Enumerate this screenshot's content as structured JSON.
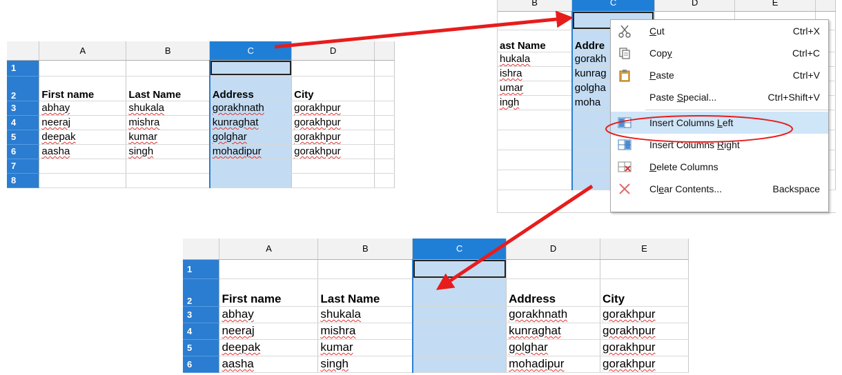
{
  "colors": {
    "accent": "#1f7fd6",
    "row_header": "#2a7dd1",
    "selection": "#c3dcf3",
    "arrow": "#e81c1c",
    "highlight": "#cfe5f8"
  },
  "before_sheet": {
    "col_headers": [
      "A",
      "B",
      "C",
      "D"
    ],
    "row_numbers": [
      "1",
      "2",
      "3",
      "4",
      "5",
      "6",
      "7",
      "8"
    ],
    "headers": [
      "First name",
      "Last Name",
      "Address",
      "City"
    ],
    "rows": [
      [
        "abhay",
        "shukala",
        "gorakhnath",
        "gorakhpur"
      ],
      [
        "neeraj",
        "mishra",
        "kunraghat",
        "gorakhpur"
      ],
      [
        "deepak",
        "kumar",
        "golghar",
        "gorakhpur"
      ],
      [
        "aasha",
        "singh",
        "mohadipur",
        "gorakhpur"
      ]
    ]
  },
  "menu_sheet": {
    "col_headers": [
      "B",
      "C",
      "D",
      "E"
    ],
    "header_fragments": [
      "ast Name",
      "Addre"
    ],
    "rows": [
      [
        "hukala",
        "gorakh"
      ],
      [
        "ishra",
        "kunrag"
      ],
      [
        "umar",
        "golgha"
      ],
      [
        "ingh",
        "moha"
      ]
    ]
  },
  "context_menu": {
    "items": [
      {
        "icon": "cut-icon",
        "pre": "",
        "key": "C",
        "post": "ut",
        "shortcut": "Ctrl+X"
      },
      {
        "icon": "copy-icon",
        "pre": "Cop",
        "key": "y",
        "post": "",
        "shortcut": "Ctrl+C"
      },
      {
        "icon": "paste-icon",
        "pre": "",
        "key": "P",
        "post": "aste",
        "shortcut": "Ctrl+V"
      },
      {
        "icon": "",
        "pre": "Paste ",
        "key": "S",
        "post": "pecial...",
        "shortcut": "Ctrl+Shift+V"
      },
      {
        "icon": "insert-columns-left-icon",
        "pre": "Insert Columns ",
        "key": "L",
        "post": "eft",
        "shortcut": ""
      },
      {
        "icon": "insert-columns-right-icon",
        "pre": "Insert Columns ",
        "key": "R",
        "post": "ight",
        "shortcut": ""
      },
      {
        "icon": "delete-columns-icon",
        "pre": "",
        "key": "D",
        "post": "elete Columns",
        "shortcut": ""
      },
      {
        "icon": "clear-contents-icon",
        "pre": "Cl",
        "key": "e",
        "post": "ar Contents...",
        "shortcut": "Backspace"
      }
    ]
  },
  "after_sheet": {
    "col_headers": [
      "A",
      "B",
      "C",
      "D",
      "E"
    ],
    "row_numbers": [
      "1",
      "2",
      "3",
      "4",
      "5",
      "6"
    ],
    "headers": [
      "First name",
      "Last Name",
      "",
      "Address",
      "City"
    ],
    "rows": [
      [
        "abhay",
        "shukala",
        "",
        "gorakhnath",
        "gorakhpur"
      ],
      [
        "neeraj",
        "mishra",
        "",
        "kunraghat",
        "gorakhpur"
      ],
      [
        "deepak",
        "kumar",
        "",
        "golghar",
        "gorakhpur"
      ],
      [
        "aasha",
        "singh",
        "",
        "mohadipur",
        "gorakhpur"
      ]
    ]
  }
}
